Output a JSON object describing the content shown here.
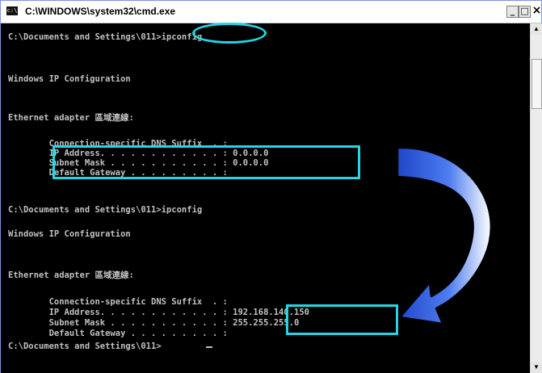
{
  "window": {
    "icon_text": "c:\\",
    "title": "C:\\WINDOWS\\system32\\cmd.exe",
    "minimize_label": "_",
    "maximize_label": "□",
    "close_label": "×"
  },
  "console": {
    "lines": [
      "C:\\Documents and Settings\\011>ipconfig",
      "Windows IP Configuration",
      "Ethernet adapter 區域連線:",
      "        Connection-specific DNS Suffix  . :",
      "        IP Address. . . . . . . . . . . . : 0.0.0.0",
      "        Subnet Mask . . . . . . . . . . . : 0.0.0.0",
      "        Default Gateway . . . . . . . . . :",
      "C:\\Documents and Settings\\011>ipconfig",
      "Windows IP Configuration",
      "Ethernet adapter 區域連線:",
      "        Connection-specific DNS Suffix  . :",
      "        IP Address. . . . . . . . . . . . : 192.168.140.150",
      "        Subnet Mask . . . . . . . . . . . : 255.255.255.0",
      "        Default Gateway . . . . . . . . . :",
      "C:\\Documents and Settings\\011>"
    ]
  },
  "annotation": {
    "highlight_color": "#22d6e8",
    "arrow_color": "#2f5ed8"
  }
}
